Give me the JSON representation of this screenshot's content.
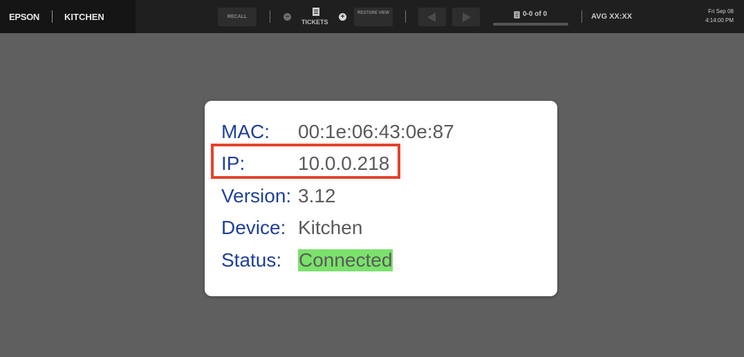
{
  "header": {
    "brand": "EPSON",
    "station": "KITCHEN",
    "recall_label": "RECALL",
    "tickets_label": "TICKETS",
    "restore_view_label": "RESTORE VIEW",
    "ticket_count": "0-0 of 0",
    "avg_label": "AVG XX:XX",
    "date": "Fri Sep 08",
    "time": "4:14:00 PM",
    "ticket_progress": 0
  },
  "icons": {
    "tickets": "ticket-icon",
    "zoom_out": "minus-icon",
    "zoom_in": "plus-icon",
    "prev": "triangle-left-icon",
    "next": "triangle-right-icon",
    "count": "ticket-icon"
  },
  "info": {
    "mac_label": "MAC:",
    "mac_value": "00:1e:06:43:0e:87",
    "ip_label": "IP:",
    "ip_value": "10.0.0.218",
    "version_label": "Version:",
    "version_value": "3.12",
    "device_label": "Device:",
    "device_value": "Kitchen",
    "status_label": "Status:",
    "status_value": "Connected"
  },
  "colors": {
    "label": "#1f3f9a",
    "value": "#5a5a5a",
    "status_bg": "#7ae26b",
    "highlight": "#e5422c"
  }
}
